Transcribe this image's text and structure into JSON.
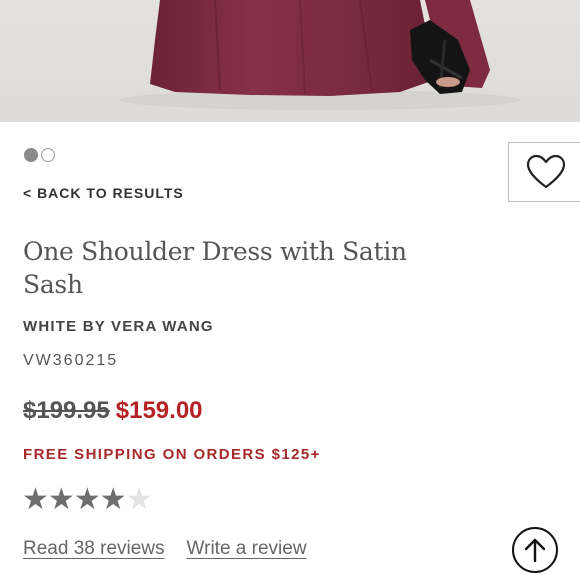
{
  "product": {
    "back_label": "< BACK TO RESULTS",
    "title": "One Shoulder Dress with Satin Sash",
    "brand": "WHITE BY VERA WANG",
    "sku": "VW360215",
    "original_price": "$199.95",
    "sale_price": "$159.00",
    "shipping_notice": "FREE SHIPPING ON ORDERS $125+",
    "rating": 4,
    "rating_max": 5,
    "read_reviews_label": "Read 38 reviews",
    "write_review_label": "Write a review"
  },
  "carousel": {
    "current": 1,
    "total": 2
  },
  "icons": {
    "wishlist": "heart-icon",
    "scroll_top": "arrow-up-circle-icon",
    "star": "star-icon"
  },
  "colors": {
    "sale_price": "#b42226",
    "shipping": "#a72a2a",
    "dress": "#7a2a3c",
    "text": "#333333"
  }
}
